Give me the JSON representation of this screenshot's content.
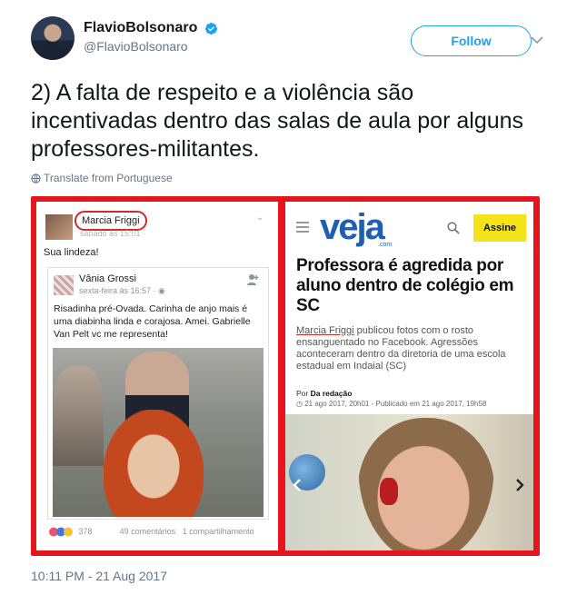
{
  "tweet": {
    "display_name": "FlavioBolsonaro",
    "handle": "@FlavioBolsonaro",
    "follow_label": "Follow",
    "text": "2) A falta de respeito e a violência são incentivadas dentro das salas de aula por alguns professores-militantes.",
    "translate_label": "Translate from Portuguese",
    "timestamp": "10:11 PM - 21 Aug 2017",
    "accent_color": "#1da1f2"
  },
  "facebook_card": {
    "name": "Marcia Friggi",
    "sub": "sábado às 15:01 ·",
    "text": "Sua lindeza!",
    "shared": {
      "name": "Vânia Grossi",
      "date": "sexta-feira às 16:57 · ",
      "text": "Risadinha pré-Ovada. Carinha de anjo mais é uma diabinha linda e corajosa. Amei. Gabrielle Van Pelt vc me representa!"
    },
    "reactions_count": "378",
    "comments": "49 comentários",
    "shares": "1 compartilhamento"
  },
  "veja_card": {
    "logo": "veja",
    "logo_sub": ".com",
    "assine_label": "Assine",
    "headline": "Professora é agredida por aluno dentro de colégio em SC",
    "lead_name": "Marcia Friggi",
    "lead_rest": " publicou fotos com o rosto ensanguentado no Facebook. Agressões aconteceram dentro da diretoria de uma escola estadual em Indaial (SC)",
    "by_prefix": "Por ",
    "by_name": "Da redação",
    "date": "21 ago 2017, 20h01 - Publicado em 21 ago 2017, 19h58",
    "assine_color": "#f3e41a"
  }
}
